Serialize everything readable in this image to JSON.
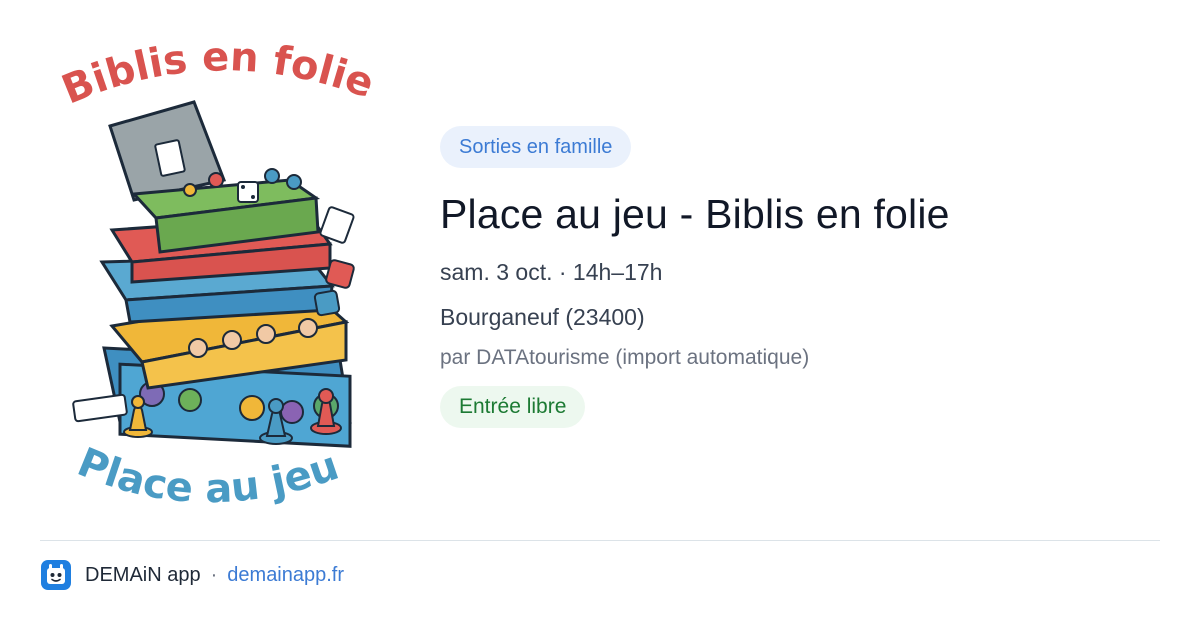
{
  "poster": {
    "top_text": "Biblis en folie",
    "bottom_text": "Place au jeu !"
  },
  "event": {
    "category": "Sorties en famille",
    "title": "Place au jeu - Biblis en folie",
    "date": "sam. 3 oct. · 14h–17h",
    "location": "Bourganeuf (23400)",
    "organizer": "par DATAtourisme (import automatique)",
    "price": "Entrée libre"
  },
  "footer": {
    "app_name": "DEMAiN app",
    "separator": "·",
    "site": "demainapp.fr",
    "icon": "app-logo-icon"
  },
  "colors": {
    "category_bg": "#eaf1fc",
    "category_text": "#3c7bd4",
    "price_bg": "#edf8ef",
    "price_text": "#1c7a33",
    "link": "#3c7bd4",
    "poster_red": "#d9534f",
    "poster_blue": "#4a9bc4"
  }
}
